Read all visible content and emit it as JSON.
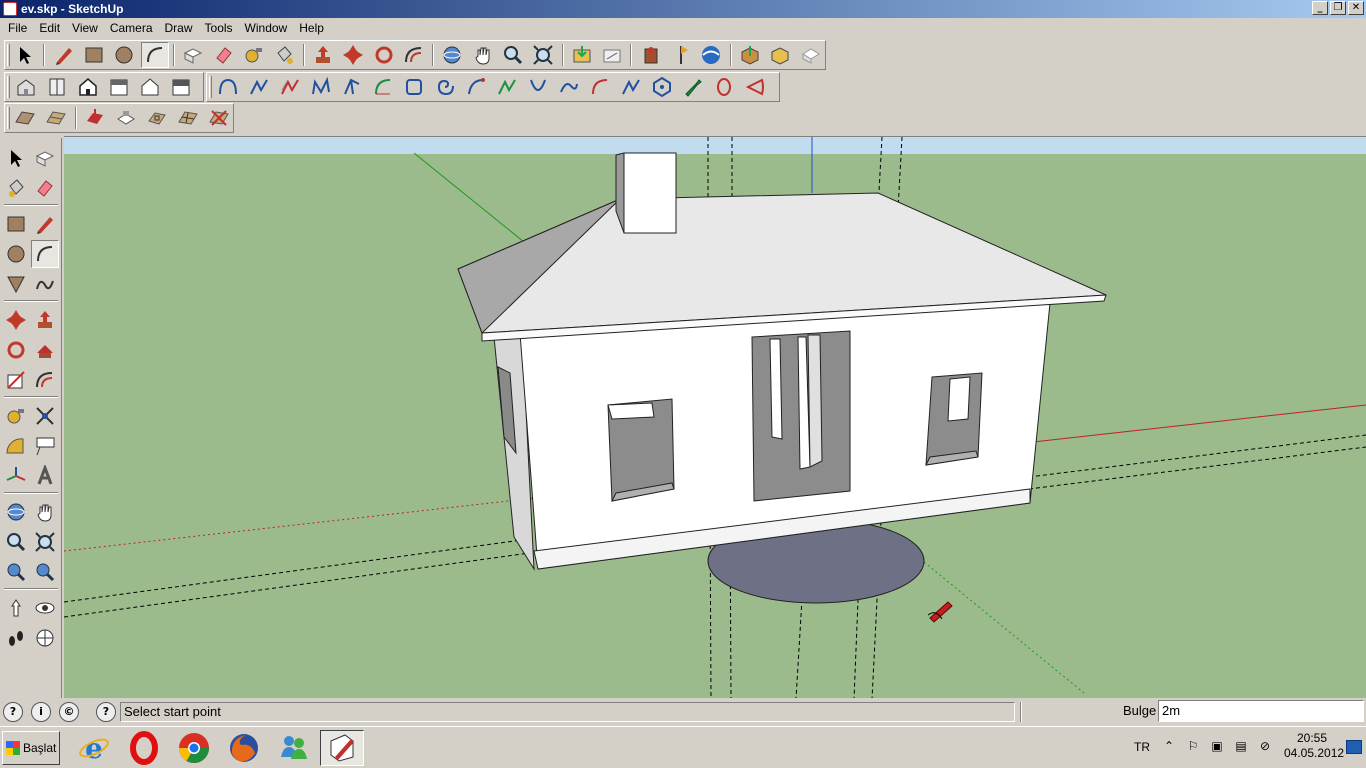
{
  "window": {
    "title": "ev.skp - SketchUp",
    "min_glyph": "_",
    "max_glyph": "❐",
    "close_glyph": "✕"
  },
  "menu": [
    "File",
    "Edit",
    "View",
    "Camera",
    "Draw",
    "Tools",
    "Window",
    "Help"
  ],
  "toolbars": {
    "standard_row": [
      "select-tool",
      "pencil-tool",
      "rectangle-tool",
      "circle-tool",
      "arc-tool",
      "make-component",
      "eraser-tool",
      "tape-measure",
      "paint-bucket",
      "push-pull",
      "move-tool",
      "rotate-tool",
      "offset-tool",
      "orbit-tool",
      "pan-tool",
      "zoom-tool",
      "zoom-extents",
      "get-models",
      "share-model",
      "place-model",
      "add-location",
      "toggle-terrain",
      "google-earth",
      "get-photo-texture",
      "share-component",
      "export-to-earth"
    ],
    "views_row": [
      "iso-view",
      "top-view",
      "front-view",
      "right-view",
      "back-view",
      "left-view",
      "xray-style",
      "wireframe-style",
      "hidden-line",
      "shaded",
      "textured",
      "monochrome",
      "bezier-curve",
      "polyline",
      "spiral",
      "helix",
      "polygon",
      "circle-3pt",
      "arc-3pt",
      "freehand",
      "curve-offset",
      "spline",
      "catenary",
      "arc-tangent",
      "round-corner",
      "regular-polygon",
      "settings-wrench",
      "ellipse",
      "sector"
    ],
    "sandbox_row": [
      "from-contours",
      "from-scratch",
      "smoove",
      "stamp",
      "drape",
      "add-detail",
      "flip-edge"
    ]
  },
  "viewport": {
    "sky_color": "#c2dcef",
    "ground_color": "#9cbb8c",
    "cursor_tool": "arc-cursor"
  },
  "status": {
    "hint_text": "Select start point",
    "vcb_label": "Bulge",
    "vcb_value": "2m"
  },
  "taskbar": {
    "start_label": "Başlat",
    "apps": [
      "internet-explorer",
      "opera",
      "chrome",
      "firefox",
      "messenger",
      "sketchup"
    ],
    "language": "TR",
    "time": "20:55",
    "date": "04.05.2012"
  }
}
